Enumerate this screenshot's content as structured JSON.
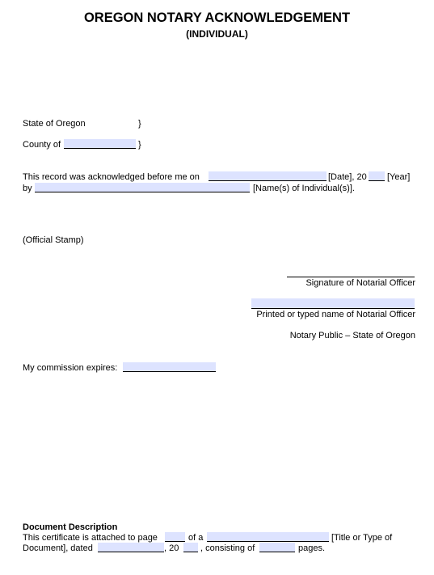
{
  "header": {
    "title": "OREGON NOTARY ACKNOWLEDGEMENT",
    "subtitle": "(INDIVIDUAL)"
  },
  "venue": {
    "state_label": "State of Oregon",
    "state_brace": "}",
    "county_label": "County of",
    "county_value": "",
    "county_brace": "}"
  },
  "acknowledgment": {
    "line1_prefix": "This record was acknowledged before me on",
    "date_value": "",
    "date_suffix": "[Date], 20",
    "year_value": "",
    "year_suffix": "[Year]",
    "line2_prefix": "by",
    "names_value": "",
    "names_suffix": "[Name(s) of Individual(s)]."
  },
  "stamp": {
    "label": "(Official Stamp)"
  },
  "signature": {
    "signature_label": "Signature of Notarial Officer",
    "printed_name_value": "",
    "printed_name_label": "Printed or typed name of Notarial Officer",
    "title_label": "Notary Public – State of Oregon"
  },
  "commission": {
    "label": "My commission expires:",
    "value": ""
  },
  "document_description": {
    "heading": "Document Description",
    "line1_prefix": "This certificate is attached to page",
    "page_value": "",
    "of_a": "of a",
    "title_value": "",
    "line1_suffix": "[Title or Type of",
    "line2_prefix": "Document], dated",
    "dated_value": "",
    "twenty": ", 20",
    "year_value": "",
    "consisting_of": ", consisting of",
    "pages_value": "",
    "pages_suffix": "pages."
  },
  "colors": {
    "field_fill": "#dde3ff"
  }
}
